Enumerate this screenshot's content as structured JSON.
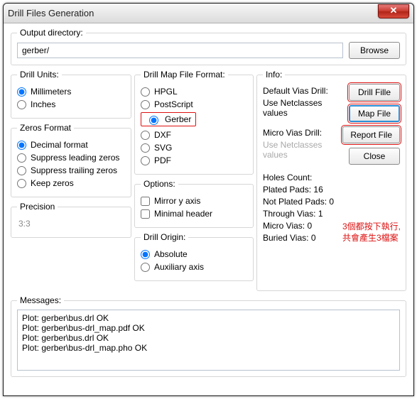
{
  "window": {
    "title": "Drill Files Generation"
  },
  "output": {
    "legend": "Output directory:",
    "value": "gerber/",
    "browse": "Browse"
  },
  "drillUnits": {
    "legend": "Drill Units:",
    "options": [
      "Millimeters",
      "Inches"
    ],
    "selected": "Millimeters"
  },
  "zerosFormat": {
    "legend": "Zeros Format",
    "options": [
      "Decimal format",
      "Suppress leading zeros",
      "Suppress trailing zeros",
      "Keep zeros"
    ],
    "selected": "Decimal format"
  },
  "precision": {
    "legend": "Precision",
    "value": "3:3"
  },
  "mapFormat": {
    "legend": "Drill Map File Format:",
    "options": [
      "HPGL",
      "PostScript",
      "Gerber",
      "DXF",
      "SVG",
      "PDF"
    ],
    "selected": "Gerber"
  },
  "options": {
    "legend": "Options:",
    "mirror": {
      "label": "Mirror y axis",
      "checked": false
    },
    "minimal": {
      "label": "Minimal header",
      "checked": false
    }
  },
  "drillOrigin": {
    "legend": "Drill Origin:",
    "options": [
      "Absolute",
      "Auxiliary axis"
    ],
    "selected": "Absolute"
  },
  "info": {
    "legend": "Info:",
    "defaultVias": "Default Vias Drill:",
    "useNet1": "Use Netclasses values",
    "microVias": "Micro Vias Drill:",
    "useNet2": "Use Netclasses values",
    "holesTitle": "Holes Count:",
    "holes": {
      "platedPads": {
        "label": "Plated Pads:",
        "value": 16
      },
      "notPlatedPads": {
        "label": "Not Plated Pads:",
        "value": 0
      },
      "throughVias": {
        "label": "Through Vias:",
        "value": 1
      },
      "microVias": {
        "label": "Micro Vias:",
        "value": 0
      },
      "buriedVias": {
        "label": "Buried Vias:",
        "value": 0
      }
    },
    "buttons": {
      "drill": "Drill Fille",
      "map": "Map File",
      "report": "Report File",
      "close": "Close"
    }
  },
  "annotation": {
    "line1": "3個都按下執行,",
    "line2": "共會產生3檔案"
  },
  "messages": {
    "legend": "Messages:",
    "lines": [
      "Plot: gerber\\bus.drl OK",
      "Plot: gerber\\bus-drl_map.pdf OK",
      "Plot: gerber\\bus.drl OK",
      "Plot: gerber\\bus-drl_map.pho OK"
    ]
  }
}
